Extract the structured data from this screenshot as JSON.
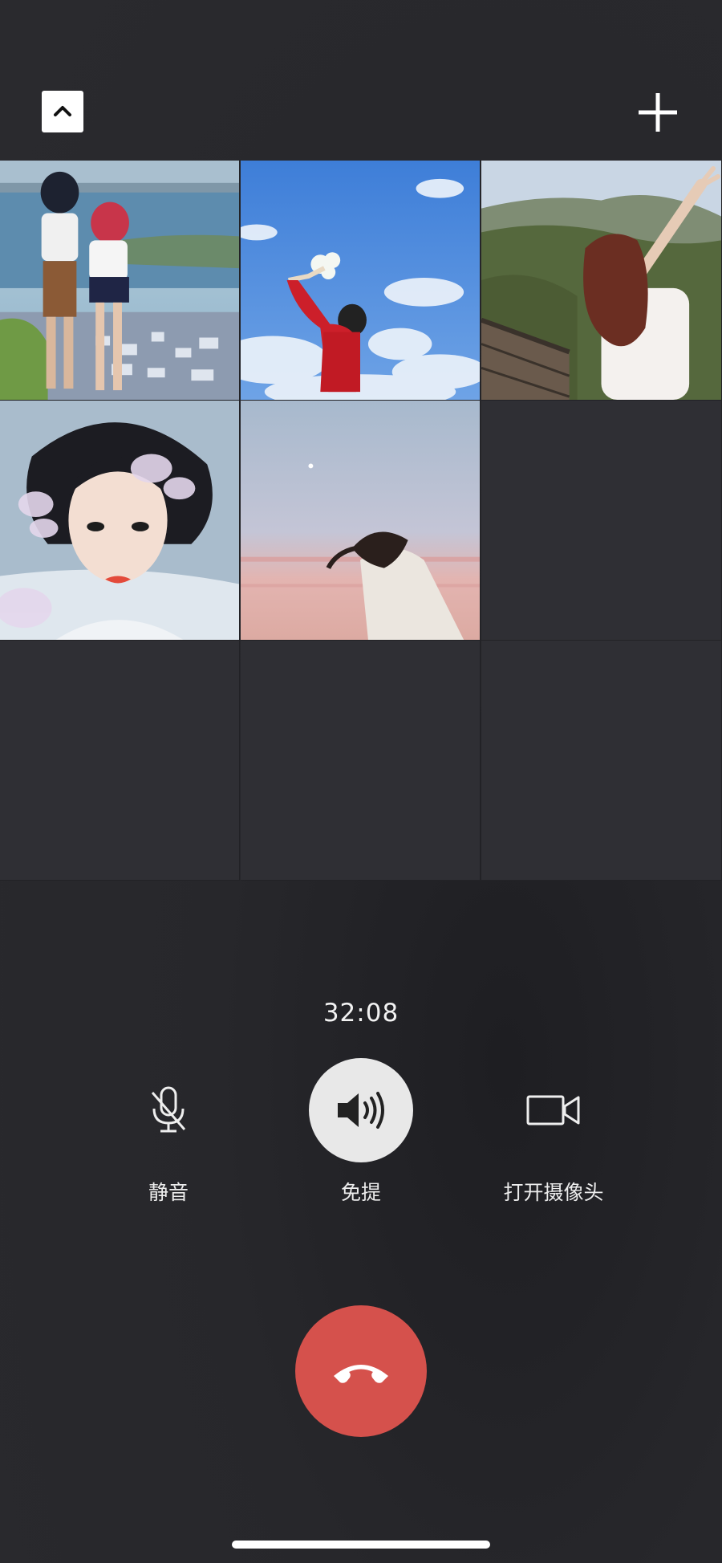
{
  "call": {
    "timer": "32:08"
  },
  "top_bar": {
    "collapse_icon": "chevron-up-icon",
    "add_icon": "plus-icon"
  },
  "participants": [
    {
      "avatar": "anime-couple-seaside"
    },
    {
      "avatar": "girl-holding-flowers-blue-sky"
    },
    {
      "avatar": "girl-on-great-wall"
    },
    {
      "avatar": "woman-portrait-feathers"
    },
    {
      "avatar": "girl-sunset-sky"
    }
  ],
  "controls": {
    "mute_label": "静音",
    "speaker_label": "免提",
    "camera_label": "打开摄像头"
  },
  "colors": {
    "background": "#2a2a2e",
    "hangup": "#d5514c",
    "speaker_active": "#e8e8e8"
  }
}
